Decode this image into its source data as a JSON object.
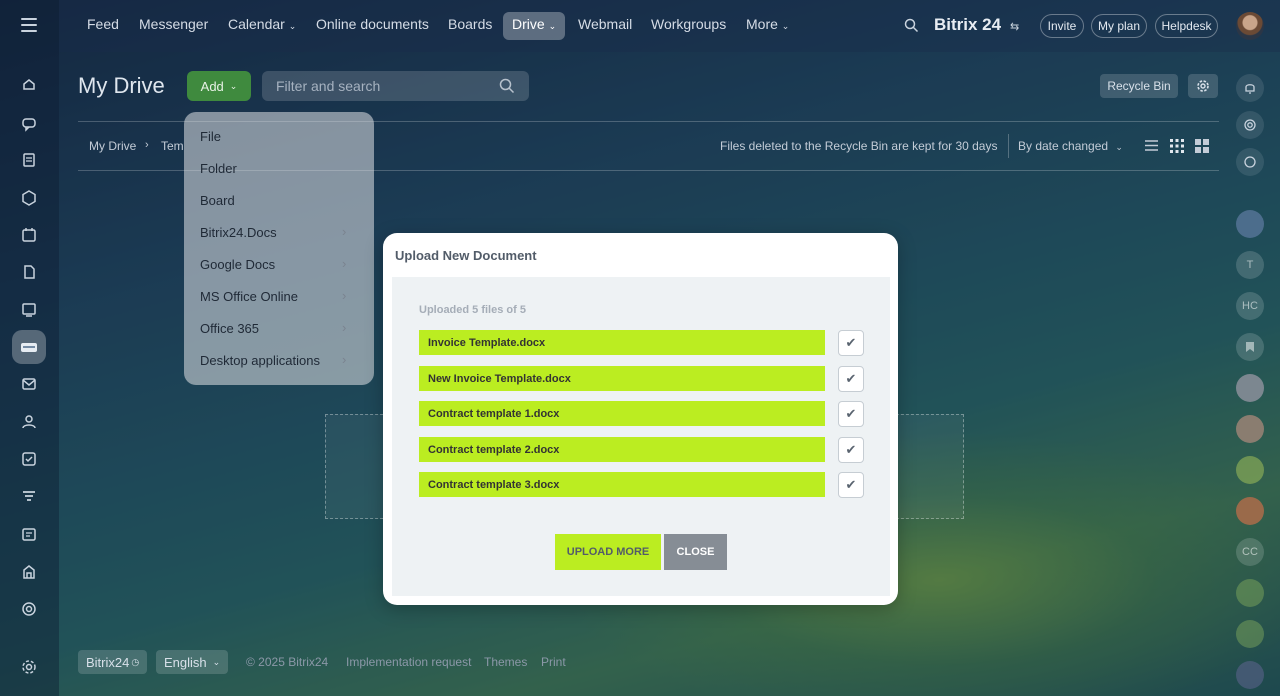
{
  "topnav": {
    "items": [
      "Feed",
      "Messenger",
      "Calendar",
      "Online documents",
      "Boards",
      "Drive",
      "Webmail",
      "Workgroups",
      "More"
    ],
    "brand": "Bitrix 24",
    "invite": "Invite",
    "my_plan": "My plan",
    "helpdesk": "Helpdesk"
  },
  "page": {
    "title": "My Drive",
    "add_label": "Add",
    "search_placeholder": "Filter and search",
    "recycle_bin": "Recycle Bin",
    "breadcrumb_root": "My Drive",
    "breadcrumb_current": "Tem",
    "recycle_info": "Files deleted to the Recycle Bin are kept for 30 days",
    "sort_label": "By date changed"
  },
  "add_menu": {
    "items": [
      "File",
      "Folder",
      "Board",
      "Bitrix24.Docs",
      "Google Docs",
      "MS Office Online",
      "Office 365",
      "Desktop applications"
    ]
  },
  "modal": {
    "title": "Upload New Document",
    "status": "Uploaded 5 files of 5",
    "files": [
      "Invoice Template.docx",
      "New Invoice Template.docx",
      "Contract template 1.docx",
      "Contract template 2.docx",
      "Contract template 3.docx"
    ],
    "upload_more": "UPLOAD MORE",
    "close": "CLOSE"
  },
  "footer": {
    "brand": "Bitrix24",
    "language": "English",
    "copyright": "© 2025 Bitrix24",
    "implementation": "Implementation request",
    "themes": "Themes",
    "print": "Print"
  },
  "rightbar": {
    "initials": [
      "T",
      "HC",
      "CC"
    ]
  },
  "colors": {
    "accent_green": "#bbed21",
    "add_button": "#3f8a3e",
    "close_button": "#868d95"
  }
}
